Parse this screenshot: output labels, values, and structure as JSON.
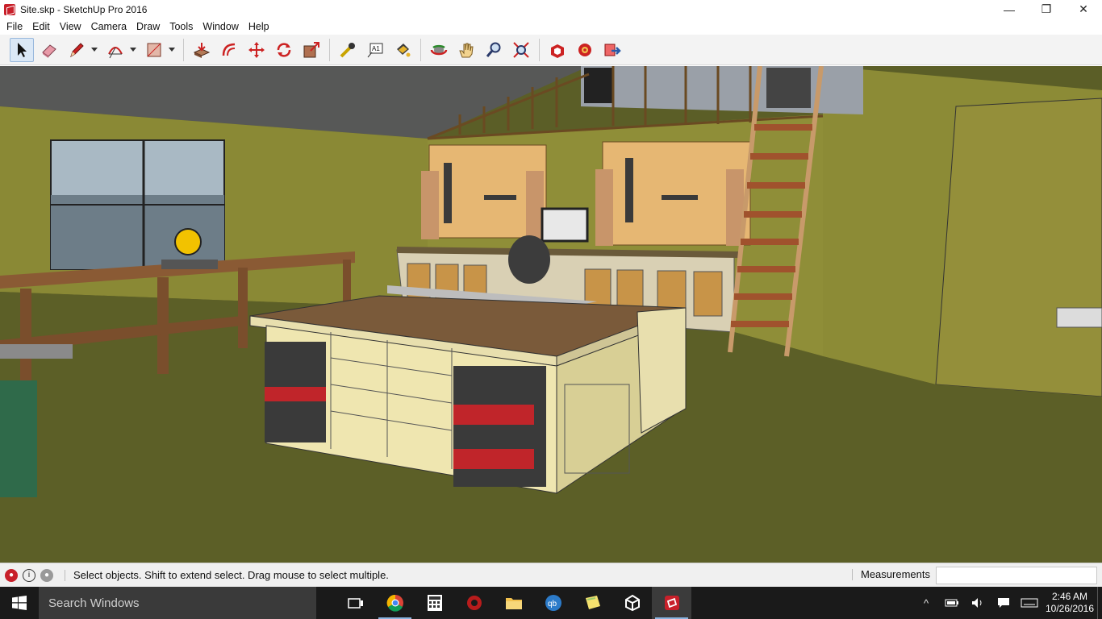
{
  "window": {
    "title": "Site.skp - SketchUp Pro 2016",
    "minimize_glyph": "—",
    "maximize_glyph": "❐",
    "close_glyph": "✕"
  },
  "menu": {
    "items": [
      "File",
      "Edit",
      "View",
      "Camera",
      "Draw",
      "Tools",
      "Window",
      "Help"
    ]
  },
  "toolbar": {
    "tools": [
      {
        "name": "select-tool",
        "icon": "arrow-cursor-icon"
      },
      {
        "name": "eraser-tool",
        "icon": "eraser-icon"
      },
      {
        "name": "pencil-tool",
        "icon": "pencil-icon"
      },
      {
        "name": "arc-tool",
        "icon": "arc-icon"
      },
      {
        "name": "rectangle-tool",
        "icon": "rectangle-icon"
      },
      {
        "name": "push-pull-tool",
        "icon": "push-pull-icon"
      },
      {
        "name": "offset-tool",
        "icon": "offset-icon"
      },
      {
        "name": "move-tool",
        "icon": "move-icon"
      },
      {
        "name": "rotate-tool",
        "icon": "rotate-icon"
      },
      {
        "name": "scale-tool",
        "icon": "scale-icon"
      },
      {
        "name": "tape-measure-tool",
        "icon": "tape-measure-icon"
      },
      {
        "name": "text-tool",
        "icon": "text-icon"
      },
      {
        "name": "paint-bucket-tool",
        "icon": "paint-bucket-icon"
      },
      {
        "name": "orbit-tool",
        "icon": "orbit-icon"
      },
      {
        "name": "pan-tool",
        "icon": "hand-icon"
      },
      {
        "name": "zoom-tool",
        "icon": "magnifier-icon"
      },
      {
        "name": "zoom-extents-tool",
        "icon": "zoom-extents-icon"
      },
      {
        "name": "3d-warehouse-tool",
        "icon": "warehouse-icon"
      },
      {
        "name": "extension-warehouse-tool",
        "icon": "extension-icon"
      },
      {
        "name": "share-model-tool",
        "icon": "share-icon"
      }
    ],
    "text_tool_glyph": "A1"
  },
  "status": {
    "message": "Select objects. Shift to extend select. Drag mouse to select multiple.",
    "info_glyph": "i",
    "measurements_label": "Measurements",
    "measurements_value": ""
  },
  "taskbar": {
    "search_placeholder": "Search Windows",
    "apps": [
      "task-view",
      "chrome",
      "calculator",
      "app-red",
      "file-explorer",
      "quickbooks",
      "sticky-notes",
      "unity",
      "sketchup"
    ],
    "qb_glyph": "qb",
    "tray_chevron": "^",
    "time": "2:46 AM",
    "date": "10/26/2016"
  },
  "colors": {
    "accent_red": "#c8202a",
    "plywood": "#8b8a35",
    "floor": "#5e6128",
    "taskbar": "#1a1a1a"
  }
}
